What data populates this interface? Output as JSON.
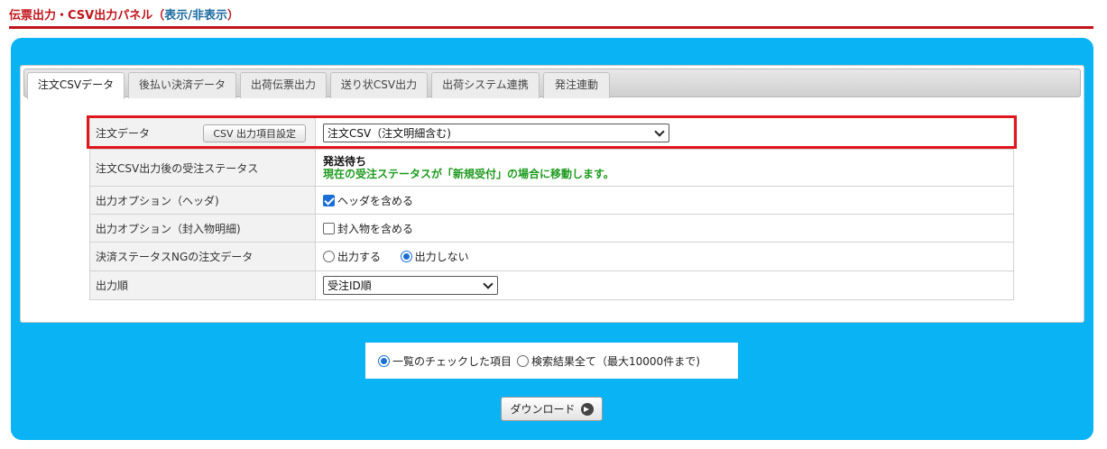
{
  "panel": {
    "title": "伝票出力・CSV出力パネル",
    "paren_open": "（",
    "toggle_label": "表示/非表示",
    "paren_close": "）"
  },
  "tabs": [
    {
      "label": "注文CSVデータ",
      "active": true
    },
    {
      "label": "後払い決済データ",
      "active": false
    },
    {
      "label": "出荷伝票出力",
      "active": false
    },
    {
      "label": "送り状CSV出力",
      "active": false
    },
    {
      "label": "出荷システム連携",
      "active": false
    },
    {
      "label": "発注連動",
      "active": false
    }
  ],
  "form": {
    "order_data": {
      "label": "注文データ",
      "settings_button": "CSV 出力項目設定",
      "selected": "注文CSV（注文明細含む)"
    },
    "post_status": {
      "label": "注文CSV出力後の受注ステータス",
      "value": "発送待ち",
      "note": "現在の受注ステータスが「新規受付」の場合に移動します。"
    },
    "header_option": {
      "label": "出力オプション（ヘッダ)",
      "checkbox_label": "ヘッダを含める",
      "checked": true
    },
    "enclosure_option": {
      "label": "出力オプション（封入物明細)",
      "checkbox_label": "封入物を含める",
      "checked": false
    },
    "ng_payment": {
      "label": "決済ステータスNGの注文データ",
      "option_output": "出力する",
      "option_no_output": "出力しない",
      "selected": "出力しない"
    },
    "order_by": {
      "label": "出力順",
      "selected": "受注ID順"
    }
  },
  "scope": {
    "option_checked_items": "一覧のチェックした項目",
    "option_all_results": "検索結果全て（最大10000件まで)",
    "selected": "一覧のチェックした項目"
  },
  "download_button": "ダウンロード",
  "colors": {
    "header_red": "#c0141a",
    "panel_blue": "#0ab4f4",
    "highlight_red": "#e0161f",
    "note_green": "#1e9a1e"
  }
}
